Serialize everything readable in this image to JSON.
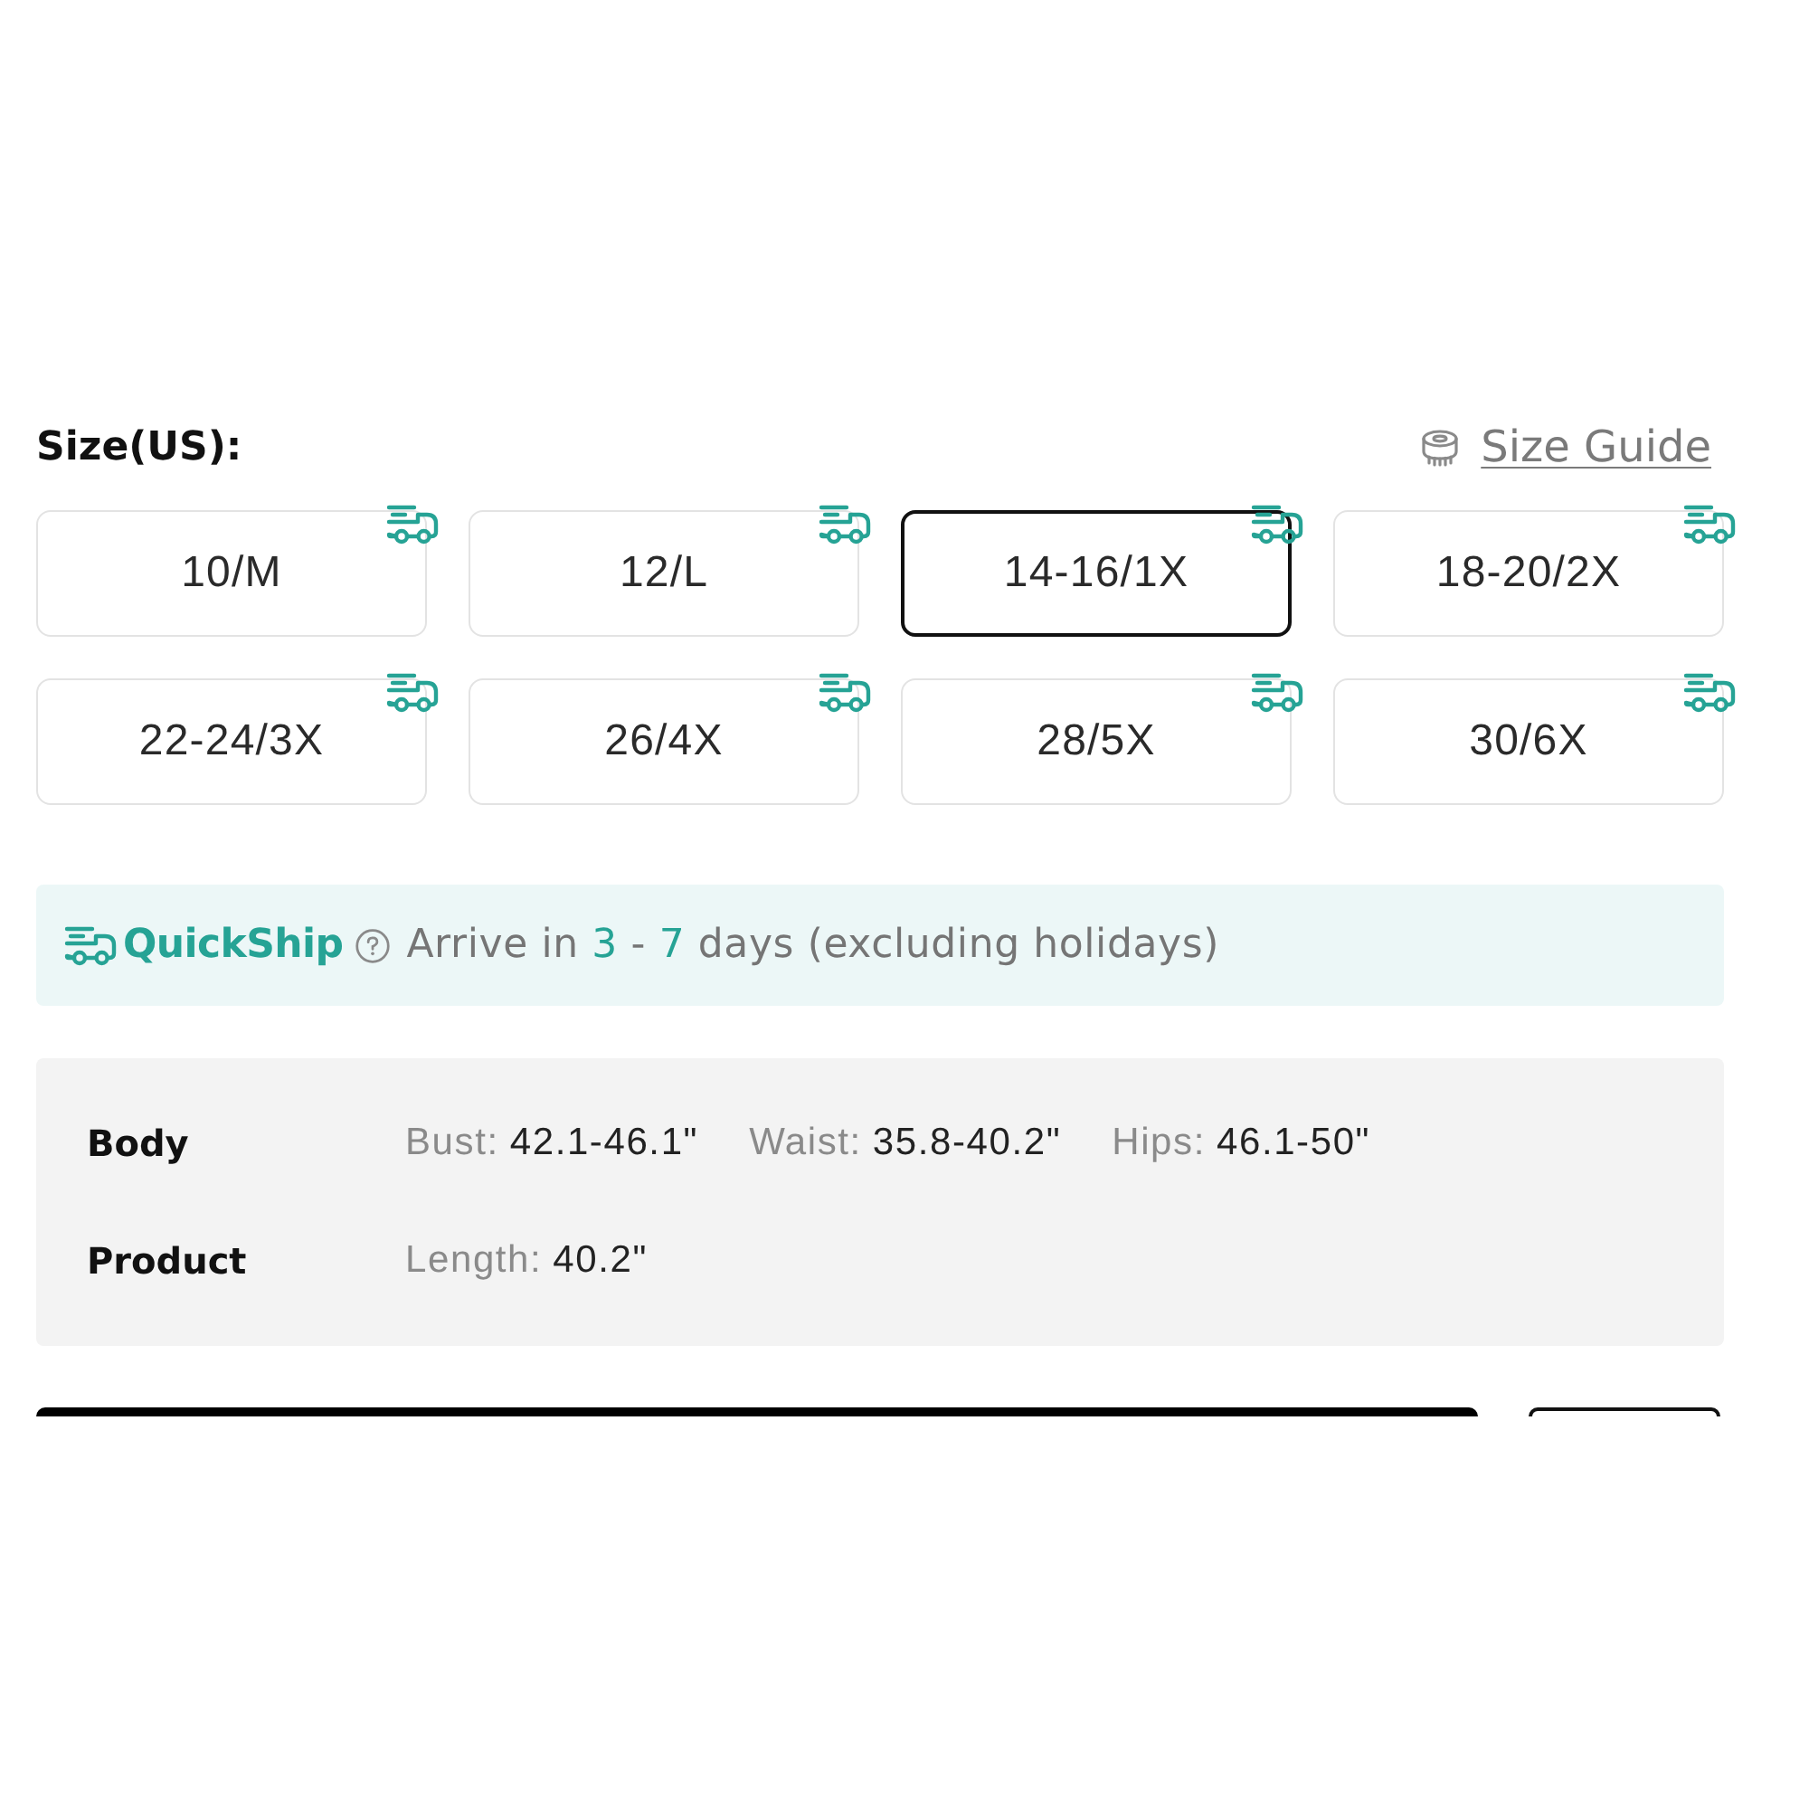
{
  "size_header": {
    "title": "Size(US):",
    "guide_link": "Size Guide"
  },
  "sizes": [
    {
      "label": "10/M",
      "selected": false,
      "quickship": true
    },
    {
      "label": "12/L",
      "selected": false,
      "quickship": true
    },
    {
      "label": "14-16/1X",
      "selected": true,
      "quickship": true
    },
    {
      "label": "18-20/2X",
      "selected": false,
      "quickship": true
    },
    {
      "label": "22-24/3X",
      "selected": false,
      "quickship": true
    },
    {
      "label": "26/4X",
      "selected": false,
      "quickship": true
    },
    {
      "label": "28/5X",
      "selected": false,
      "quickship": true
    },
    {
      "label": "30/6X",
      "selected": false,
      "quickship": true
    }
  ],
  "quickship": {
    "label": "QuickShip",
    "message": [
      {
        "text": "Arrive in",
        "highlight": false
      },
      {
        "text": "3",
        "highlight": true
      },
      {
        "text": "-",
        "highlight": false
      },
      {
        "text": "7",
        "highlight": true
      },
      {
        "text": "days (excluding holidays)",
        "highlight": false
      }
    ]
  },
  "measurements": [
    {
      "group": "Body",
      "items": [
        {
          "label": "Bust:",
          "value": "42.1-46.1\""
        },
        {
          "label": "Waist:",
          "value": "35.8-40.2\""
        },
        {
          "label": "Hips:",
          "value": "46.1-50\""
        }
      ]
    },
    {
      "group": "Product",
      "items": [
        {
          "label": "Length:",
          "value": "40.2\""
        }
      ]
    }
  ],
  "action_buttons": [
    {
      "kind": "filled"
    },
    {
      "kind": "outlined"
    }
  ]
}
